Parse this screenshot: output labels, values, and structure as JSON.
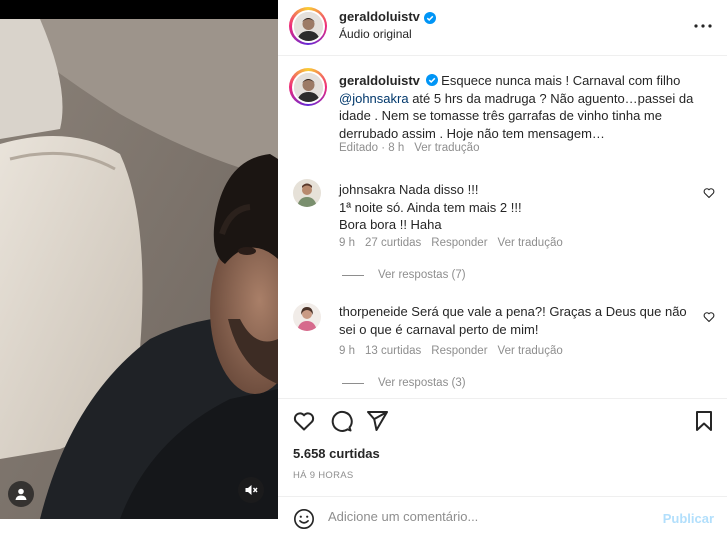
{
  "post": {
    "author": "geraldoluistv",
    "audio_label": "Áudio original",
    "caption_prefix": "Esquece nunca mais ! Carnaval com filho",
    "caption_mention": "@johnsakra",
    "caption_rest": "até 5 hrs da madruga ? Não aguento…passei da idade . Nem se tomasse três garrafas de vinho tinha me derrubado assim . Hoje não tem mensagem…",
    "edited_label": "Editado",
    "time": "8 h",
    "see_translation": "Ver tradução",
    "likes": "5.658 curtidas",
    "time_ago": "HÁ 9 HORAS"
  },
  "comments": [
    {
      "username": "johnsakra",
      "lines": [
        "Nada disso !!!",
        "1ª noite só. Ainda tem mais 2 !!!",
        "Bora bora !! Haha"
      ],
      "time": "9 h",
      "likes": "27 curtidas",
      "reply": "Responder",
      "translate": "Ver tradução",
      "view_replies": "Ver respostas (7)"
    },
    {
      "username": "thorpeneide",
      "text": "Será que vale a pena?! Graças a Deus que não sei o que é carnaval perto de mim!",
      "time": "9 h",
      "likes": "13 curtidas",
      "reply": "Responder",
      "translate": "Ver tradução",
      "view_replies": "Ver respostas (3)"
    }
  ],
  "composer": {
    "placeholder": "Adicione um comentário...",
    "post_label": "Publicar"
  },
  "icons": {
    "verified": "verified-badge-icon",
    "more": "more-options-icon",
    "like": "heart-icon",
    "comment": "comment-icon",
    "share": "paper-plane-icon",
    "save": "bookmark-icon",
    "emoji": "emoji-icon",
    "tag": "user-tag-icon",
    "mute": "muted-speaker-icon"
  },
  "colors": {
    "verified": "#0095f6",
    "mention": "#00376b",
    "secondary_text": "#8e8e8e",
    "post_disabled": "#b2dffc"
  }
}
